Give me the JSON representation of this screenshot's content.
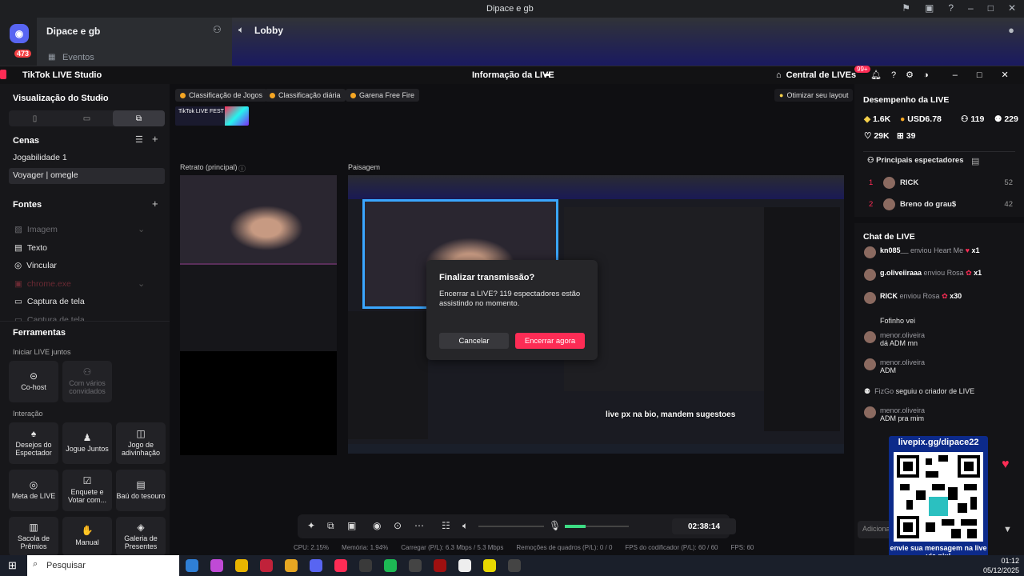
{
  "discord": {
    "window_title": "Dipace e gb",
    "notification_badge": "473",
    "server_name": "Dipace e gb",
    "events_label": "Eventos",
    "voice_channel": "Lobby"
  },
  "studio": {
    "app_title": "TikTok LIVE Studio",
    "center_title": "Informação da LIVE",
    "central_lives": "Central de LIVEs",
    "notif_badge": "99+"
  },
  "left": {
    "view_label": "Visualização do Studio",
    "scenes_label": "Cenas",
    "scenes": [
      "Jogabilidade 1",
      "Voyager | omegle"
    ],
    "sources_label": "Fontes",
    "sources": [
      {
        "label": "Imagem",
        "enabled": false
      },
      {
        "label": "Texto",
        "enabled": true
      },
      {
        "label": "Vincular",
        "enabled": true
      },
      {
        "label": "chrome.exe",
        "enabled": false
      },
      {
        "label": "Captura de tela",
        "enabled": true
      },
      {
        "label": "Captura de tela",
        "enabled": false
      }
    ],
    "tools_label": "Ferramentas",
    "start_live_label": "Iniciar LIVE juntos",
    "cohost": "Co-host",
    "multi_guest": "Com vários convidados",
    "interaction_label": "Interação",
    "tools": [
      "Desejos do Espectador",
      "Jogue Juntos",
      "Jogo de adivinhação",
      "Meta de LIVE",
      "Enquete e Votar com...",
      "Baú do tesouro",
      "Sacola de Prêmios",
      "Manual",
      "Galeria de Presentes"
    ]
  },
  "center": {
    "chips": [
      "Classificação de Jogos",
      "Classificação diária",
      "Garena Free Fire"
    ],
    "optimize": "Otimizar seu layout",
    "fest_banner": "TikTok LIVE FEST 25",
    "portrait_label": "Retrato (principal)",
    "landscape_label": "Paisagem",
    "overlay_text": "live px na bio, mandem sugestoes",
    "timer": "02:38:14",
    "stats": [
      "CPU: 2.15%",
      "Memória: 1.94%",
      "Carregar (P/L): 6.3 Mbps / 5.3 Mbps",
      "Remoções de quadros (P/L): 0 / 0",
      "FPS do codificador (P/L): 60 / 60",
      "FPS: 60"
    ]
  },
  "dialog": {
    "title": "Finalizar transmissão?",
    "message": "Encerrar a LIVE? 119 espectadores estão assistindo no momento.",
    "cancel": "Cancelar",
    "confirm": "Encerrar agora"
  },
  "right": {
    "performance_label": "Desempenho da LIVE",
    "stat_diamonds": "1.6K",
    "stat_usd": "USD6.78",
    "stat_viewers": "119",
    "stat_users": "229",
    "stat_likes": "29K",
    "stat_gifts": "39",
    "top_viewers_label": "Principais espectadores",
    "top_viewers": [
      {
        "rank": "1",
        "name": "RICK",
        "score": "52"
      },
      {
        "rank": "2",
        "name": "Breno do grau$",
        "score": "42"
      }
    ],
    "chat_label": "Chat de LIVE",
    "gift_events": [
      {
        "user": "kn085__",
        "text": "enviou Heart Me",
        "count": "x1"
      },
      {
        "user": "g.oliveiiraaa",
        "text": "enviou Rosa",
        "count": "x1"
      },
      {
        "user": "RICK",
        "text": "enviou Rosa",
        "count": "x30"
      }
    ],
    "chat": [
      {
        "user": "",
        "msg": "Fofinho vei"
      },
      {
        "user": "menor.oliveira",
        "msg": "dá ADM mn"
      },
      {
        "user": "menor.oliveira",
        "msg": "ADM"
      },
      {
        "user": "FizGo",
        "msg": "seguiu o criador de LIVE"
      },
      {
        "user": "menor.oliveira",
        "msg": "ADM pra mim"
      }
    ],
    "input_placeholder": "Adicionar comentário"
  },
  "qr": {
    "url": "livepix.gg/dipace22",
    "footer": "envie sua mensagem na live via pix!"
  },
  "taskbar": {
    "search": "Pesquisar",
    "time": "01:12",
    "date": "05/12/2025"
  }
}
